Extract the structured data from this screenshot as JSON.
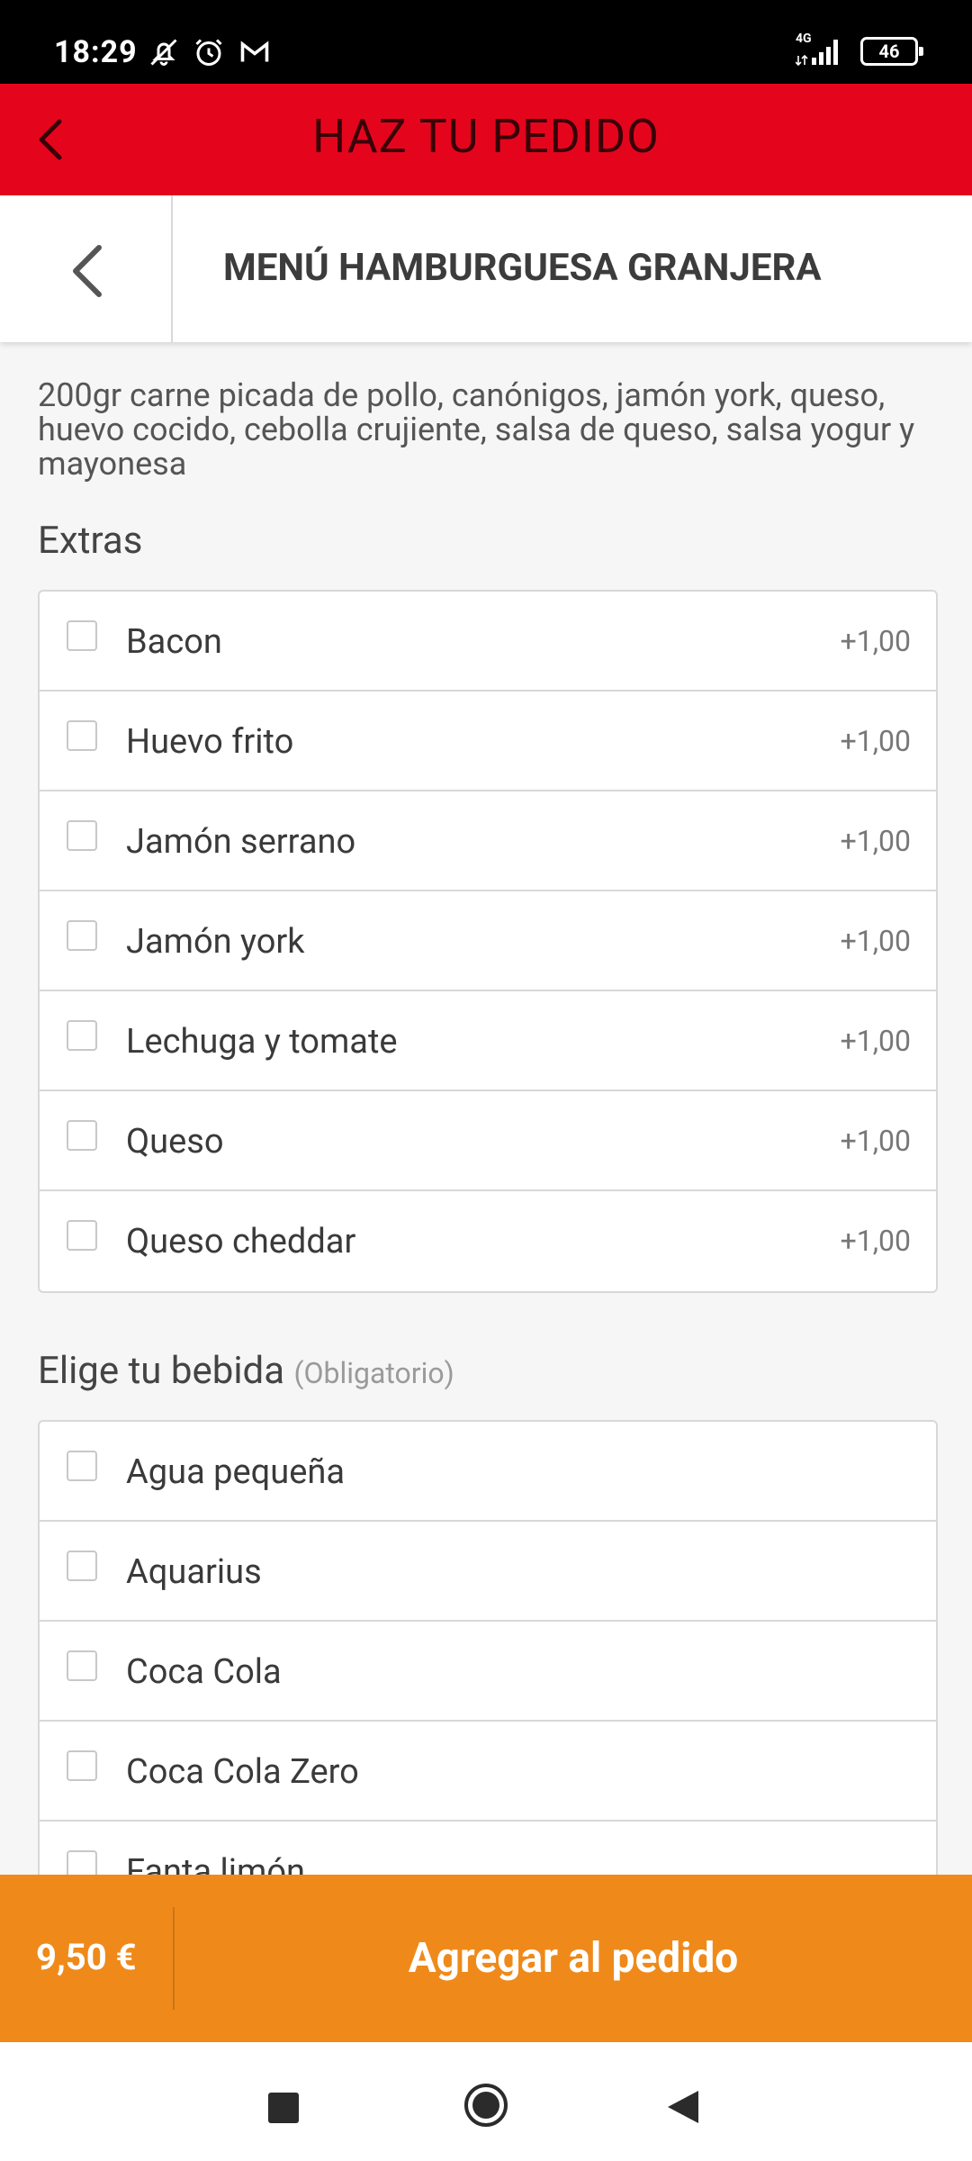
{
  "status_bar": {
    "time": "18:29",
    "network": "4G",
    "battery": "46"
  },
  "app_bar": {
    "title": "HAZ TU PEDIDO"
  },
  "product": {
    "title": "MENÚ HAMBURGUESA GRANJERA",
    "description": "200gr carne picada de pollo, canónigos, jamón york, queso, huevo cocido, cebolla crujiente, salsa de queso, salsa yogur y mayonesa"
  },
  "extras": {
    "title": "Extras",
    "options": [
      {
        "label": "Bacon",
        "price": "+1,00"
      },
      {
        "label": "Huevo frito",
        "price": "+1,00"
      },
      {
        "label": "Jamón serrano",
        "price": "+1,00"
      },
      {
        "label": "Jamón york",
        "price": "+1,00"
      },
      {
        "label": "Lechuga y tomate",
        "price": "+1,00"
      },
      {
        "label": "Queso",
        "price": "+1,00"
      },
      {
        "label": "Queso cheddar",
        "price": "+1,00"
      }
    ]
  },
  "drinks": {
    "title": "Elige tu bebida",
    "note": "(Obligatorio)",
    "options": [
      {
        "label": "Agua pequeña"
      },
      {
        "label": "Aquarius"
      },
      {
        "label": "Coca Cola"
      },
      {
        "label": "Coca Cola Zero"
      },
      {
        "label": "Fanta limón"
      }
    ]
  },
  "footer": {
    "price": "9,50 €",
    "add_button": "Agregar al pedido"
  },
  "colors": {
    "app_bar": "#e4051d",
    "footer": "#ef8a1a"
  }
}
